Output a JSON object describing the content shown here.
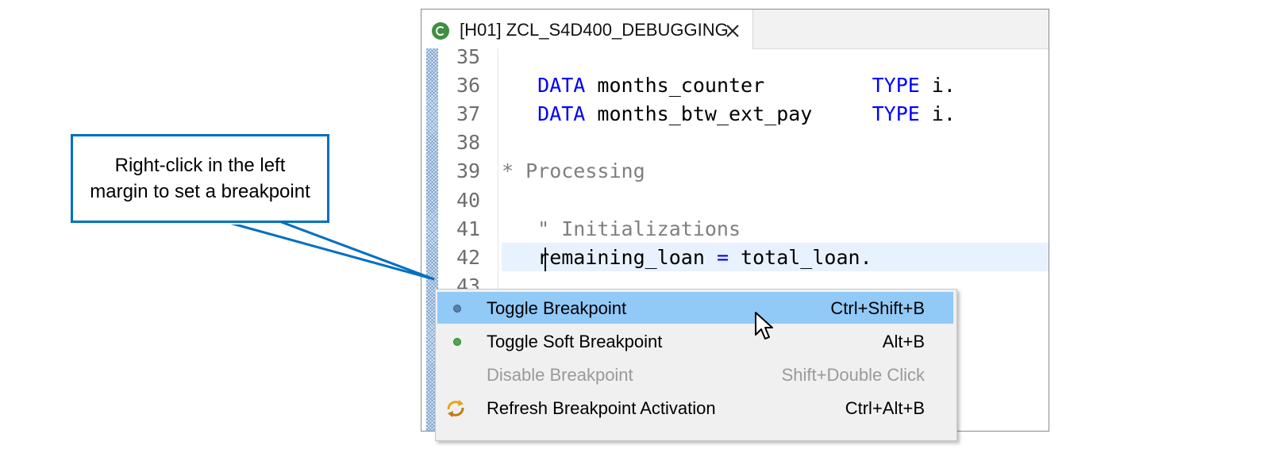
{
  "callout": {
    "text": "Right-click in the left margin to set a breakpoint",
    "color": "#0070c0"
  },
  "editor": {
    "tab": {
      "icon": "class-icon",
      "title": "[H01] ZCL_S4D400_DEBUGGING",
      "close_icon": "close-icon"
    },
    "lines": [
      {
        "number": "35",
        "tokens": []
      },
      {
        "number": "36",
        "tokens": [
          {
            "t": "   ",
            "c": ""
          },
          {
            "t": "DATA",
            "c": "kw"
          },
          {
            "t": " months_counter         ",
            "c": ""
          },
          {
            "t": "TYPE",
            "c": "kw"
          },
          {
            "t": " i.",
            "c": ""
          }
        ]
      },
      {
        "number": "37",
        "tokens": [
          {
            "t": "   ",
            "c": ""
          },
          {
            "t": "DATA",
            "c": "kw"
          },
          {
            "t": " months_btw_ext_pay     ",
            "c": ""
          },
          {
            "t": "TYPE",
            "c": "kw"
          },
          {
            "t": " i.",
            "c": ""
          }
        ]
      },
      {
        "number": "38",
        "tokens": []
      },
      {
        "number": "39",
        "tokens": [
          {
            "t": "* Processing",
            "c": "cmt"
          }
        ]
      },
      {
        "number": "40",
        "tokens": []
      },
      {
        "number": "41",
        "tokens": [
          {
            "t": "   ",
            "c": ""
          },
          {
            "t": "\" Initializations",
            "c": "cmt"
          }
        ]
      },
      {
        "number": "42",
        "tokens": [
          {
            "t": "   remaining_loan ",
            "c": ""
          },
          {
            "t": "=",
            "c": "kw"
          },
          {
            "t": " total_loan.",
            "c": ""
          }
        ]
      },
      {
        "number": "43",
        "tokens": []
      }
    ],
    "current_line": "42"
  },
  "context_menu": {
    "items": [
      {
        "label": "Toggle Breakpoint",
        "shortcut": "Ctrl+Shift+B",
        "icon": "breakpoint-dot-icon",
        "icon_color": "#5a7fa8",
        "state": "hover"
      },
      {
        "label": "Toggle Soft Breakpoint",
        "shortcut": "Alt+B",
        "icon": "soft-breakpoint-dot-icon",
        "icon_color": "#4ea64e",
        "state": "normal"
      },
      {
        "label": "Disable Breakpoint",
        "shortcut": "Shift+Double Click",
        "icon": "",
        "icon_color": "",
        "state": "disabled"
      },
      {
        "label": "Refresh Breakpoint Activation",
        "shortcut": "Ctrl+Alt+B",
        "icon": "refresh-icon",
        "icon_color": "#e8a317",
        "state": "normal"
      }
    ],
    "hover_color": "#91c9f7"
  }
}
